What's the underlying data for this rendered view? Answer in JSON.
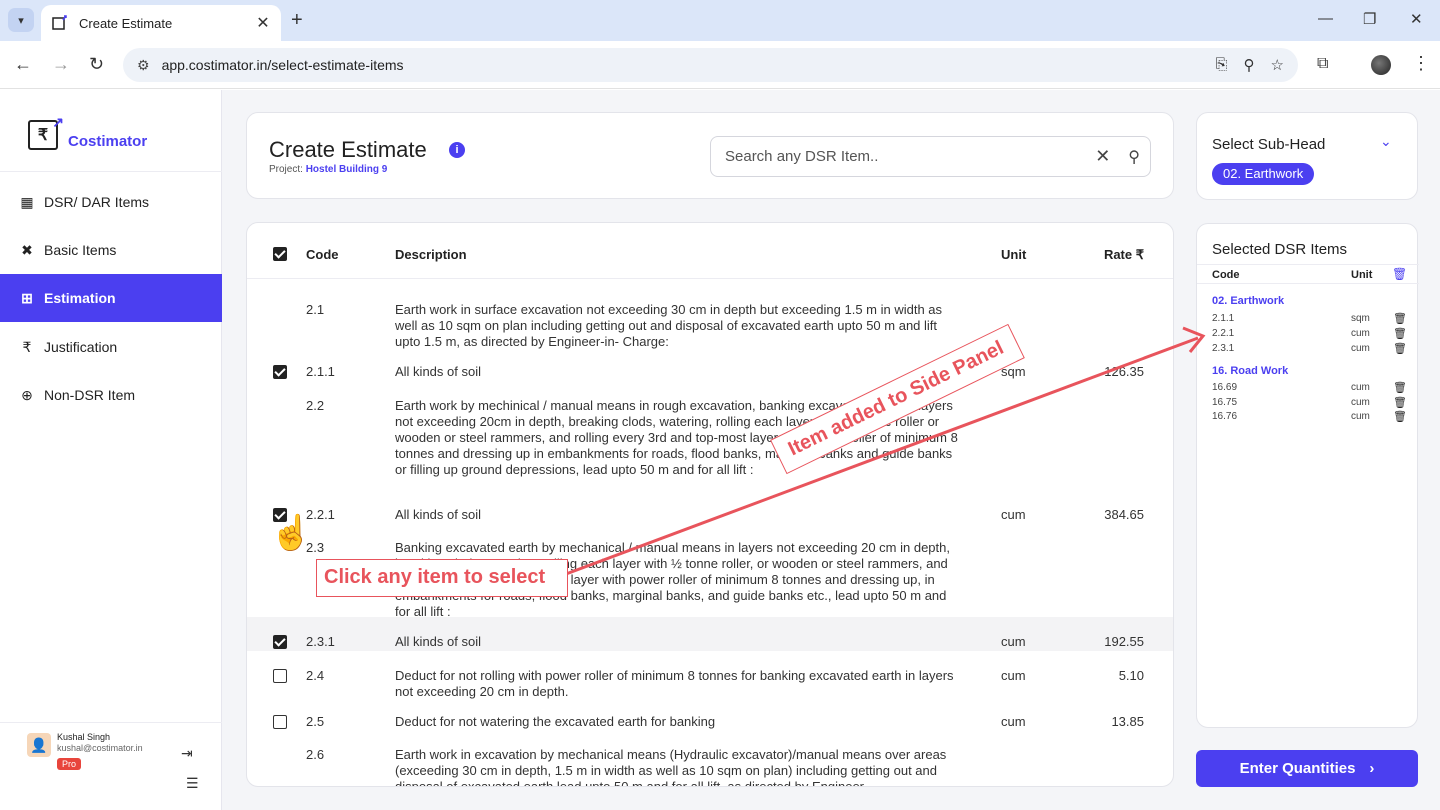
{
  "browser": {
    "tab_title": "Create Estimate",
    "url": "app.costimator.in/select-estimate-items"
  },
  "sidebar": {
    "brand": "Costimator",
    "items": [
      {
        "label": "DSR/ DAR Items",
        "icon": "table-icon",
        "active": false
      },
      {
        "label": "Basic Items",
        "icon": "tools-icon",
        "active": false
      },
      {
        "label": "Estimation",
        "icon": "grid-icon",
        "active": true
      },
      {
        "label": "Justification",
        "icon": "rupee-icon",
        "active": false
      },
      {
        "label": "Non-DSR Item",
        "icon": "plus-box-icon",
        "active": false
      }
    ],
    "user": {
      "name": "Kushal Singh",
      "email": "kushal@costimator.in",
      "badge": "Pro"
    }
  },
  "header": {
    "title": "Create Estimate",
    "project_label": "Project:",
    "project_name": "Hostel Building 9",
    "search_placeholder": "Search any DSR Item.."
  },
  "table": {
    "columns": {
      "code": "Code",
      "description": "Description",
      "unit": "Unit",
      "rate": "Rate ₹"
    },
    "rows": [
      {
        "code": "2.1",
        "checkbox": null,
        "desc": "Earth work in surface excavation not exceeding 30 cm in depth but exceeding 1.5 m in width as well as 10 sqm on plan including getting out and disposal of excavated earth upto 50 m and lift upto 1.5 m, as directed by Engineer-in- Charge:",
        "unit": "",
        "rate": ""
      },
      {
        "code": "2.1.1",
        "checkbox": true,
        "desc": "All kinds of soil",
        "unit": "sqm",
        "rate": "126.35"
      },
      {
        "code": "2.2",
        "checkbox": null,
        "desc": "Earth work by mechinical / manual means in rough excavation, banking excavated earth in layers not exceeding 20cm in depth, breaking clods, watering, rolling each layer with ½ tonne roller or wooden or steel rammers, and rolling every 3rd and top-most layer with power roller of minimum 8 tonnes and dressing up in embankments for roads, flood banks, marginal banks and guide banks or filling up ground depressions, lead upto 50 m and for all lift :",
        "unit": "",
        "rate": ""
      },
      {
        "code": "2.2.1",
        "checkbox": true,
        "desc": "All kinds of soil",
        "unit": "cum",
        "rate": "384.65"
      },
      {
        "code": "2.3",
        "checkbox": null,
        "desc": "Banking excavated earth by mechanical / manual means in layers not exceeding 20 cm in depth, breaking clods, watering, rolling each layer with ½ tonne roller, or wooden or steel rammers, and rolling every 3rd and top-most layer with power roller of minimum 8 tonnes and dressing up, in embankments for roads, flood banks, marginal banks, and guide banks etc., lead upto 50 m and for all lift :",
        "unit": "",
        "rate": ""
      },
      {
        "code": "2.3.1",
        "checkbox": true,
        "desc": "All kinds of soil",
        "unit": "cum",
        "rate": "192.55"
      },
      {
        "code": "2.4",
        "checkbox": false,
        "desc": "Deduct for not rolling with power roller of minimum 8 tonnes for banking excavated earth in layers not exceeding 20 cm in depth.",
        "unit": "cum",
        "rate": "5.10"
      },
      {
        "code": "2.5",
        "checkbox": false,
        "desc": "Deduct for not watering the excavated earth for banking",
        "unit": "cum",
        "rate": "13.85"
      },
      {
        "code": "2.6",
        "checkbox": null,
        "desc": "Earth work in excavation by mechanical means (Hydraulic excavator)/manual means over areas (exceeding 30 cm in depth, 1.5 m in width as well as 10 sqm on plan) including getting out and disposal of excavated earth lead upto 50 m and for all lift, as directed by Engineer",
        "unit": "",
        "rate": ""
      }
    ]
  },
  "subhead": {
    "title": "Select Sub-Head",
    "chip": "02. Earthwork"
  },
  "selected": {
    "title": "Selected DSR Items",
    "col_code": "Code",
    "col_unit": "Unit",
    "groups": [
      {
        "name": "02. Earthwork",
        "items": [
          {
            "code": "2.1.1",
            "unit": "sqm"
          },
          {
            "code": "2.2.1",
            "unit": "cum"
          },
          {
            "code": "2.3.1",
            "unit": "cum"
          }
        ]
      },
      {
        "name": "16. Road Work",
        "items": [
          {
            "code": "16.69",
            "unit": "cum"
          },
          {
            "code": "16.75",
            "unit": "cum"
          },
          {
            "code": "16.76",
            "unit": "cum"
          }
        ]
      }
    ]
  },
  "enter_button": "Enter Quantities",
  "annotations": {
    "click": "Click any item to select",
    "added": "Item added to Side Panel"
  },
  "colors": {
    "accent": "#4b3ff0",
    "annotation": "#e8545c"
  }
}
